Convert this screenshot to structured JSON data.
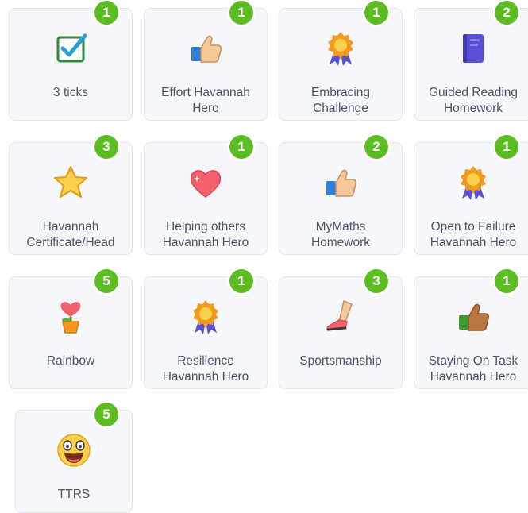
{
  "awards": [
    {
      "label": "3 ticks",
      "count": "1",
      "icon": "checkbox-icon"
    },
    {
      "label": "Effort Havannah\nHero",
      "count": "1",
      "icon": "thumbs-up-icon"
    },
    {
      "label": "Embracing\nChallenge",
      "count": "1",
      "icon": "medal-icon"
    },
    {
      "label": "Guided Reading\nHomework",
      "count": "2",
      "icon": "book-icon"
    },
    {
      "label": "Havannah\nCertificate/Head",
      "count": "3",
      "icon": "star-icon"
    },
    {
      "label": "Helping others\nHavannah Hero",
      "count": "1",
      "icon": "heart-icon"
    },
    {
      "label": "MyMaths\nHomework",
      "count": "2",
      "icon": "thumbs-up-icon"
    },
    {
      "label": "Open to Failure\nHavannah Hero",
      "count": "1",
      "icon": "medal-icon"
    },
    {
      "label": "Rainbow",
      "count": "5",
      "icon": "potted-heart-icon"
    },
    {
      "label": "Resilience\nHavannah Hero",
      "count": "1",
      "icon": "medal-icon"
    },
    {
      "label": "Sportsmanship",
      "count": "3",
      "icon": "leg-icon"
    },
    {
      "label": "Staying On Task\nHavannah Hero",
      "count": "1",
      "icon": "thumbs-up-dark-icon"
    },
    {
      "label": "TTRS",
      "count": "5",
      "icon": "grinning-face-icon"
    }
  ],
  "colors": {
    "badge": "#5bbd21",
    "card_background": "#f6f7fb",
    "label_text": "#4d5468"
  }
}
